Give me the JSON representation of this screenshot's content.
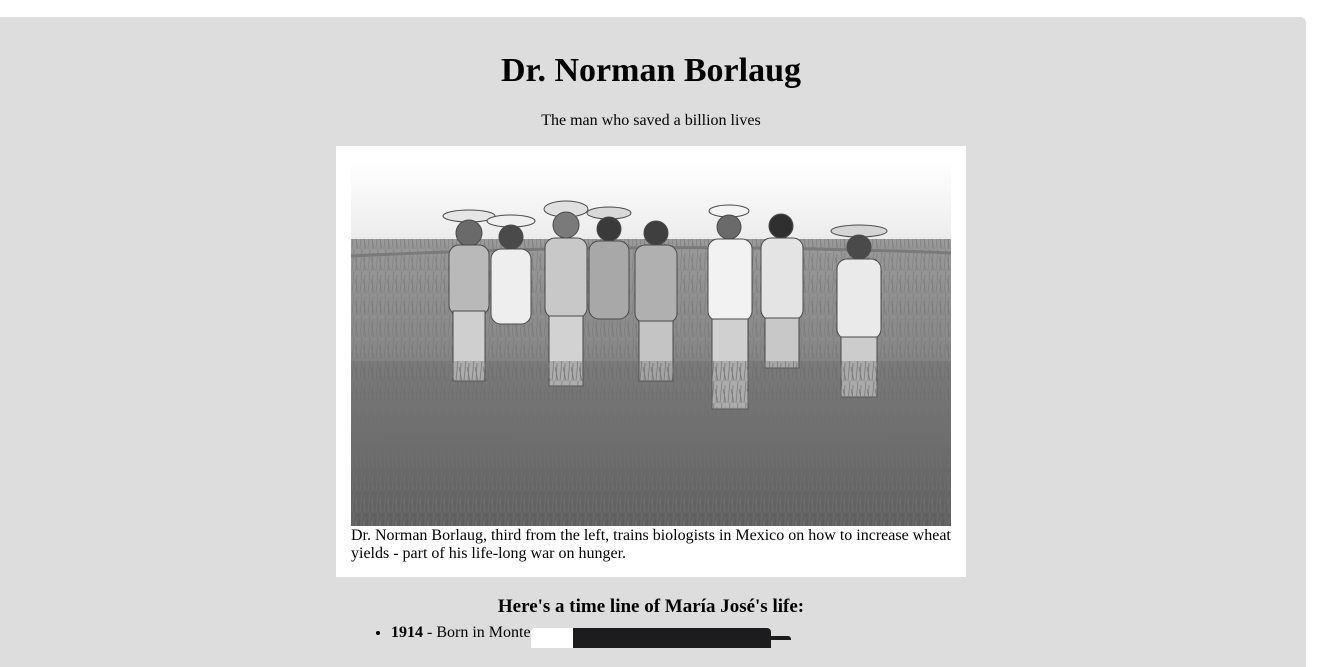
{
  "page": {
    "title": "Dr. Norman Borlaug",
    "subtitle": "The man who saved a billion lives"
  },
  "figure": {
    "image_alt": "Black and white photo of Dr. Norman Borlaug with a group of men standing in a wheat field",
    "caption": "Dr. Norman Borlaug, third from the left, trains biologists in Mexico on how to increase wheat yields - part of his life-long war on hunger."
  },
  "timeline": {
    "heading": "Here's a time line of María José's life:",
    "items": [
      {
        "year": "1914",
        "text": " - Born in Monte"
      }
    ]
  },
  "colors": {
    "page_background": "#ffffff",
    "main_background": "#dddddd",
    "figure_background": "#ffffff",
    "overlay_dark": "#1c1c1e"
  }
}
